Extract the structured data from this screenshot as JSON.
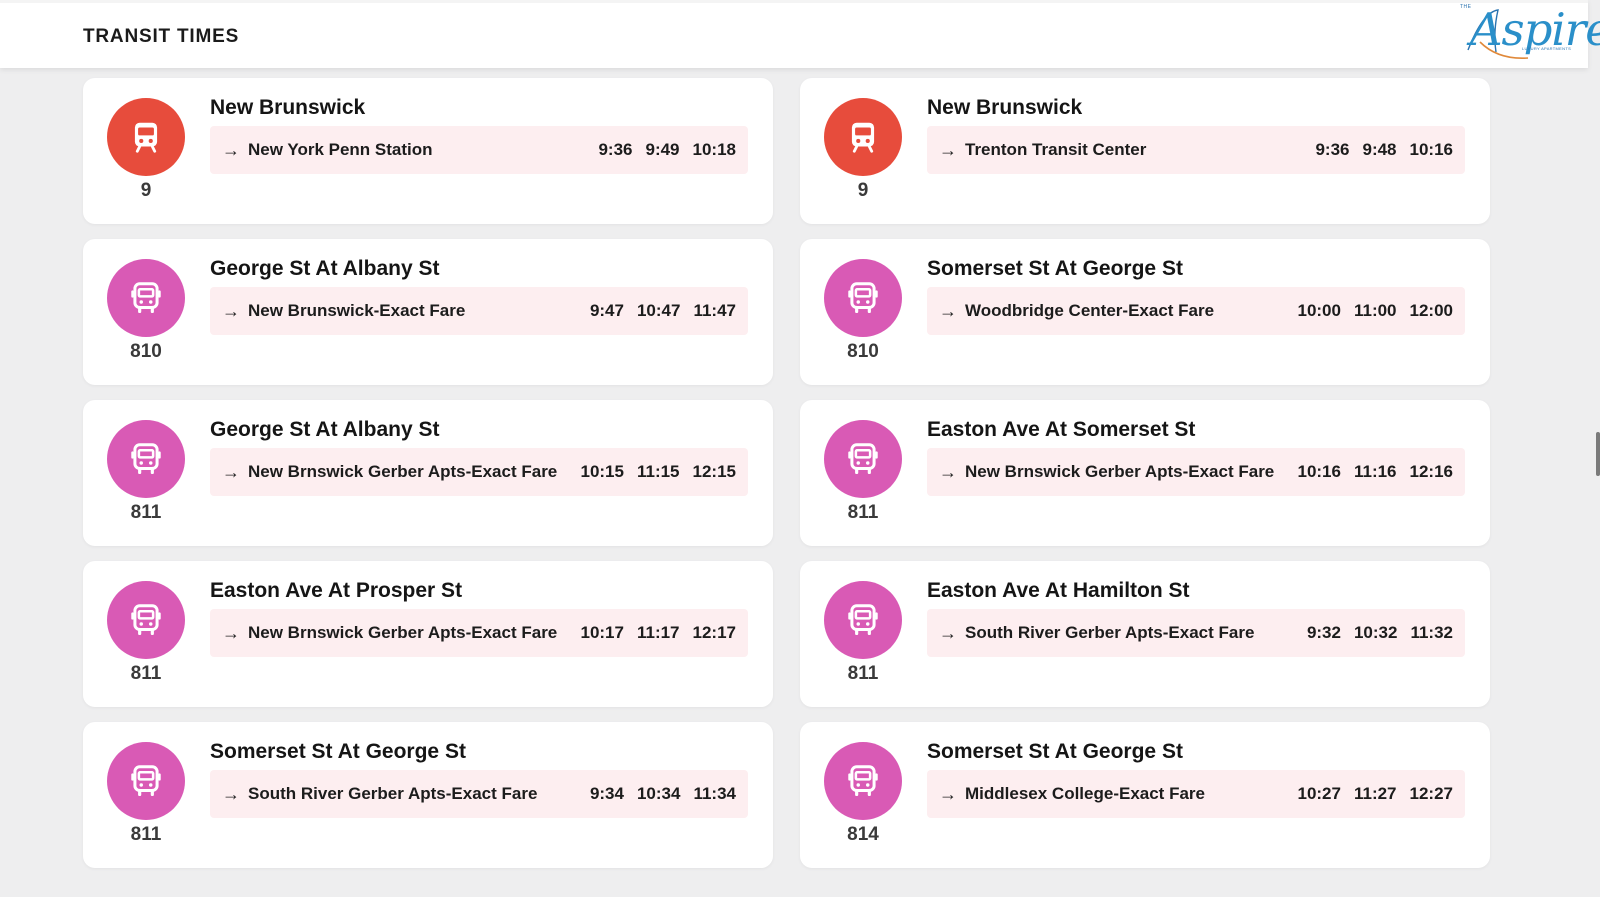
{
  "header": {
    "title": "TRANSIT TIMES",
    "logo_text": "Aspire",
    "logo_small": "THE",
    "logo_tagline": "LUXURY APARTMENTS"
  },
  "colors": {
    "train": "#e74c3c",
    "bus": "#d95ab5",
    "destination_bg": "#fdeef0"
  },
  "cards": [
    {
      "icon": "train-icon",
      "route": "9",
      "stop": "New Brunswick",
      "destination": "New York Penn Station",
      "times": [
        "9:36",
        "9:49",
        "10:18"
      ]
    },
    {
      "icon": "train-icon",
      "route": "9",
      "stop": "New Brunswick",
      "destination": "Trenton Transit Center",
      "times": [
        "9:36",
        "9:48",
        "10:16"
      ]
    },
    {
      "icon": "bus-icon",
      "route": "810",
      "stop": "George St At Albany St",
      "destination": "New Brunswick-Exact Fare",
      "times": [
        "9:47",
        "10:47",
        "11:47"
      ]
    },
    {
      "icon": "bus-icon",
      "route": "810",
      "stop": "Somerset St At George St",
      "destination": "Woodbridge Center-Exact Fare",
      "times": [
        "10:00",
        "11:00",
        "12:00"
      ]
    },
    {
      "icon": "bus-icon",
      "route": "811",
      "stop": "George St At Albany St",
      "destination": "New Brnswick Gerber Apts-Exact Fare",
      "times": [
        "10:15",
        "11:15",
        "12:15"
      ]
    },
    {
      "icon": "bus-icon",
      "route": "811",
      "stop": "Easton Ave At Somerset St",
      "destination": "New Brnswick Gerber Apts-Exact Fare",
      "times": [
        "10:16",
        "11:16",
        "12:16"
      ]
    },
    {
      "icon": "bus-icon",
      "route": "811",
      "stop": "Easton Ave At Prosper St",
      "destination": "New Brnswick Gerber Apts-Exact Fare",
      "times": [
        "10:17",
        "11:17",
        "12:17"
      ]
    },
    {
      "icon": "bus-icon",
      "route": "811",
      "stop": "Easton Ave At Hamilton St",
      "destination": "South River Gerber Apts-Exact Fare",
      "times": [
        "9:32",
        "10:32",
        "11:32"
      ]
    },
    {
      "icon": "bus-icon",
      "route": "811",
      "stop": "Somerset St At George St",
      "destination": "South River Gerber Apts-Exact Fare",
      "times": [
        "9:34",
        "10:34",
        "11:34"
      ]
    },
    {
      "icon": "bus-icon",
      "route": "814",
      "stop": "Somerset St At George St",
      "destination": "Middlesex College-Exact Fare",
      "times": [
        "10:27",
        "11:27",
        "12:27"
      ]
    }
  ]
}
